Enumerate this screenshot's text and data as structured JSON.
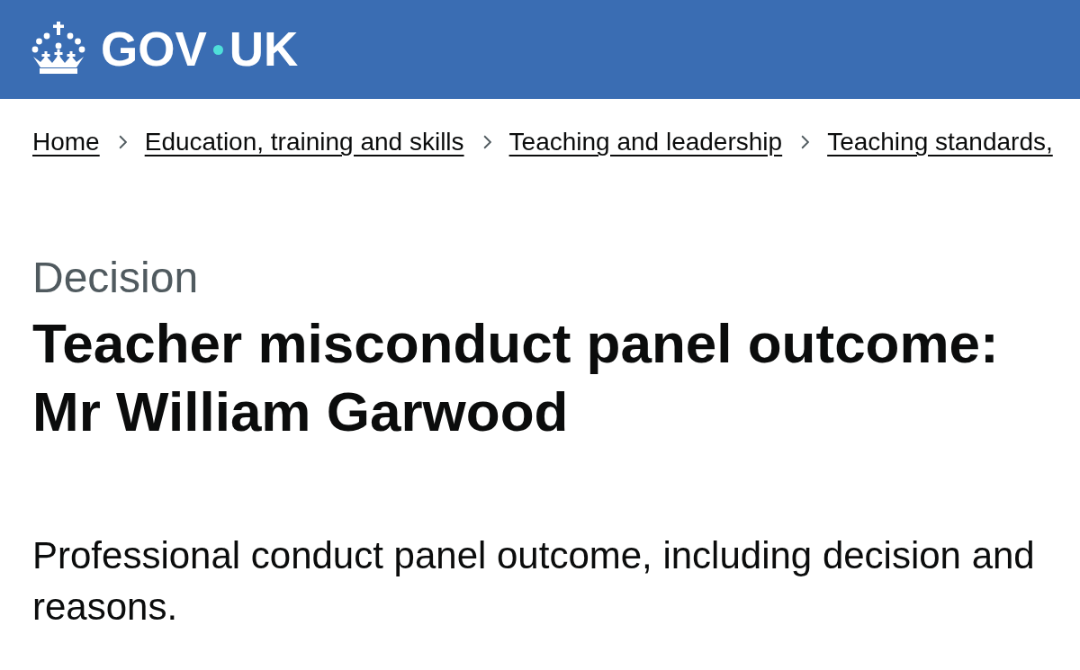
{
  "header": {
    "logo": {
      "words": [
        "GOV",
        "UK"
      ]
    }
  },
  "breadcrumbs": [
    "Home",
    "Education, training and skills",
    "Teaching and leadership",
    "Teaching standards,"
  ],
  "caption": "Decision",
  "title": "Teacher misconduct panel outcome: Mr William Garwood",
  "lead": "Professional conduct panel outcome, including decision and reasons."
}
